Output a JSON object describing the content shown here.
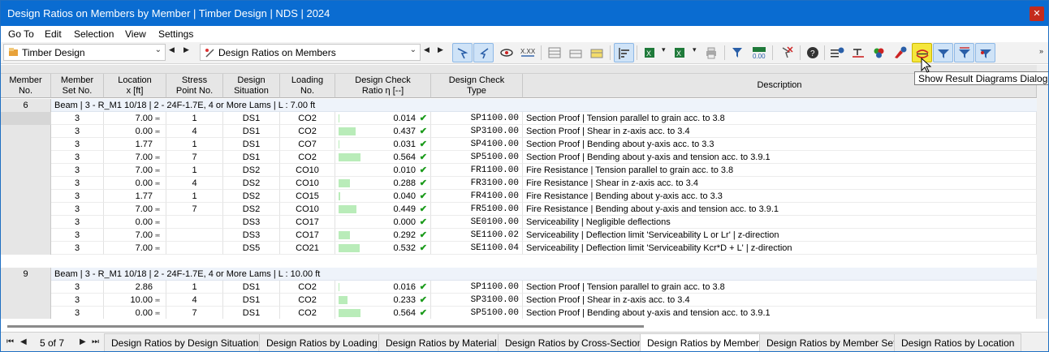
{
  "window": {
    "title": "Design Ratios on Members by Member | Timber Design | NDS | 2024",
    "close_glyph": "✕"
  },
  "menu": [
    "Go To",
    "Edit",
    "Selection",
    "View",
    "Settings"
  ],
  "toolbar": {
    "module_combo": "Timber Design",
    "result_combo": "Design Ratios on Members",
    "tooltip": "Show Result Diagrams Dialog",
    "accent_color": "#0a6cd1",
    "highlight_color": "#f5e63c",
    "icons": [
      "select-objects-icon",
      "jump-to-icon",
      "view-results-icon",
      "xxx-values-icon",
      "table-icon",
      "export-icon",
      "highlight-table-icon",
      "sort-icon",
      "excel-export-icon",
      "excel-import-icon",
      "print-icon",
      "filter-icon",
      "decimal-icon",
      "deselect-icon",
      "help-icon",
      "info-list-icon",
      "section-icon",
      "color-icon",
      "member-info-icon",
      "result-diagrams-icon",
      "filter-down-icon",
      "filter-clear-icon",
      "filter-pin-icon",
      "more-icon"
    ]
  },
  "columns": {
    "member_no": "Member\nNo.",
    "member_set_no": "Member\nSet No.",
    "location": "Location\nx [ft]",
    "stress_point": "Stress\nPoint No.",
    "design_situation": "Design\nSituation",
    "loading": "Loading\nNo.",
    "ratio": "Design Check\nRatio η [--]",
    "check_type": "Design Check\nType",
    "description": "Description"
  },
  "groups": [
    {
      "member_no": "6",
      "header": "Beam | 3 - R_M1 10/18 | 2 - 24F-1.7E, 4 or More Lams | L : 7.00 ft",
      "rows": [
        {
          "set": "3",
          "x": "7.00",
          "xmark": true,
          "sp": "1",
          "ds": "DS1",
          "lo": "CO2",
          "ratio": "0.014",
          "r": 0.014,
          "type": "SP1100.00",
          "desc": "Section Proof | Tension parallel to grain acc. to 3.8"
        },
        {
          "set": "3",
          "x": "0.00",
          "xmark": true,
          "sp": "4",
          "ds": "DS1",
          "lo": "CO2",
          "ratio": "0.437",
          "r": 0.437,
          "type": "SP3100.00",
          "desc": "Section Proof | Shear in z-axis acc. to 3.4"
        },
        {
          "set": "3",
          "x": "1.77",
          "xmark": false,
          "sp": "1",
          "ds": "DS1",
          "lo": "CO7",
          "ratio": "0.031",
          "r": 0.031,
          "type": "SP4100.00",
          "desc": "Section Proof | Bending about y-axis acc. to 3.3"
        },
        {
          "set": "3",
          "x": "7.00",
          "xmark": true,
          "sp": "7",
          "ds": "DS1",
          "lo": "CO2",
          "ratio": "0.564",
          "r": 0.564,
          "type": "SP5100.00",
          "desc": "Section Proof | Bending about y-axis and tension acc. to 3.9.1"
        },
        {
          "set": "3",
          "x": "7.00",
          "xmark": true,
          "sp": "1",
          "ds": "DS2",
          "lo": "CO10",
          "ratio": "0.010",
          "r": 0.01,
          "type": "FR1100.00",
          "desc": "Fire Resistance | Tension parallel to grain acc. to 3.8"
        },
        {
          "set": "3",
          "x": "0.00",
          "xmark": true,
          "sp": "4",
          "ds": "DS2",
          "lo": "CO10",
          "ratio": "0.288",
          "r": 0.288,
          "type": "FR3100.00",
          "desc": "Fire Resistance | Shear in z-axis acc. to 3.4"
        },
        {
          "set": "3",
          "x": "1.77",
          "xmark": false,
          "sp": "1",
          "ds": "DS2",
          "lo": "CO15",
          "ratio": "0.040",
          "r": 0.04,
          "type": "FR4100.00",
          "desc": "Fire Resistance | Bending about y-axis acc. to 3.3"
        },
        {
          "set": "3",
          "x": "7.00",
          "xmark": true,
          "sp": "7",
          "ds": "DS2",
          "lo": "CO10",
          "ratio": "0.449",
          "r": 0.449,
          "type": "FR5100.00",
          "desc": "Fire Resistance | Bending about y-axis and tension acc. to 3.9.1"
        },
        {
          "set": "3",
          "x": "0.00",
          "xmark": true,
          "sp": "",
          "ds": "DS3",
          "lo": "CO17",
          "ratio": "0.000",
          "r": 0.0,
          "type": "SE0100.00",
          "desc": "Serviceability | Negligible deflections"
        },
        {
          "set": "3",
          "x": "7.00",
          "xmark": true,
          "sp": "",
          "ds": "DS3",
          "lo": "CO17",
          "ratio": "0.292",
          "r": 0.292,
          "type": "SE1100.02",
          "desc": "Serviceability | Deflection limit 'Serviceability L or Lr' | z-direction"
        },
        {
          "set": "3",
          "x": "7.00",
          "xmark": true,
          "sp": "",
          "ds": "DS5",
          "lo": "CO21",
          "ratio": "0.532",
          "r": 0.532,
          "type": "SE1100.04",
          "desc": "Serviceability | Deflection limit 'Serviceability Kcr*D + L' | z-direction"
        }
      ]
    },
    {
      "member_no": "9",
      "header": "Beam | 3 - R_M1 10/18 | 2 - 24F-1.7E, 4 or More Lams | L : 10.00 ft",
      "rows": [
        {
          "set": "3",
          "x": "2.86",
          "xmark": false,
          "sp": "1",
          "ds": "DS1",
          "lo": "CO2",
          "ratio": "0.016",
          "r": 0.016,
          "type": "SP1100.00",
          "desc": "Section Proof | Tension parallel to grain acc. to 3.8"
        },
        {
          "set": "3",
          "x": "10.00",
          "xmark": true,
          "sp": "4",
          "ds": "DS1",
          "lo": "CO2",
          "ratio": "0.233",
          "r": 0.233,
          "type": "SP3100.00",
          "desc": "Section Proof | Shear in z-axis acc. to 3.4"
        },
        {
          "set": "3",
          "x": "0.00",
          "xmark": true,
          "sp": "7",
          "ds": "DS1",
          "lo": "CO2",
          "ratio": "0.564",
          "r": 0.564,
          "type": "SP5100.00",
          "desc": "Section Proof | Bending about y-axis and tension acc. to 3.9.1"
        }
      ]
    }
  ],
  "ratio_bar_color": "#b9ecb9",
  "check_mark": "✔",
  "x_marker": "≖",
  "statusbar": {
    "page": "5 of 7",
    "tabs": [
      "Design Ratios by Design Situation",
      "Design Ratios by Loading",
      "Design Ratios by Material",
      "Design Ratios by Cross-Section",
      "Design Ratios by Member",
      "Design Ratios by Member Set",
      "Design Ratios by Location"
    ],
    "active_tab": 4
  }
}
